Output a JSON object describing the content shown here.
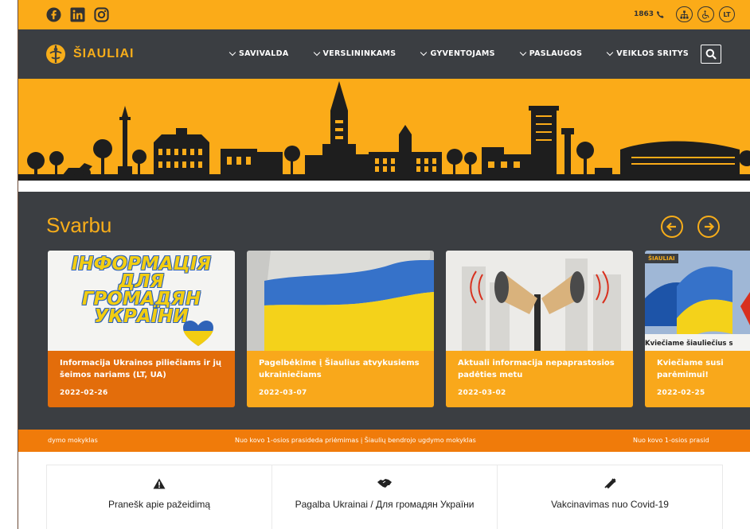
{
  "topbar": {
    "social_icons": [
      "facebook-icon",
      "linkedin-icon",
      "instagram-icon"
    ],
    "phone": "1863",
    "sitemap_icon": "sitemap-icon",
    "accessibility_icon": "wheelchair-icon",
    "language": "LT"
  },
  "nav": {
    "logo_text": "ŠIAULIAI",
    "menu": [
      "SAVIVALDA",
      "VERSLININKAMS",
      "GYVENTOJAMS",
      "PASLAUGOS",
      "VEIKLOS SRITYS"
    ],
    "search_icon": "search-icon"
  },
  "svarbu": {
    "title": "Svarbu",
    "cards": [
      {
        "image_text_lines": [
          "ІНФОРМАЦІЯ",
          "ДЛЯ",
          "ГРОМАДЯН",
          "УКРАЇНИ"
        ],
        "title": "Informacija Ukrainos piliečiams ir jų šeimos nariams (LT, UA)",
        "date": "2022-02-26",
        "color": "#e36d0b"
      },
      {
        "title": "Pagelbėkime į Šiaulius atvykusiems ukrainiečiams",
        "date": "2022-03-07",
        "color": "#f9a81b"
      },
      {
        "title": "Aktuali informacija nepaprastosios padėties metu",
        "date": "2022-03-02",
        "color": "#f9a81b"
      },
      {
        "badge": "ŠIAULIAI",
        "overlay": "Kviečiame šiauliečius s",
        "title": "Kviečiame susi parėmimui!",
        "date": "2022-02-25",
        "color": "#f9a81b"
      }
    ]
  },
  "ticker": {
    "items": [
      "dymo mokyklas",
      "Nuo kovo 1-osios prasideda priėmimas į Šiaulių bendrojo ugdymo mokyklas",
      "Nuo kovo 1-osios prasid"
    ]
  },
  "quick_links": [
    {
      "icon": "warning-icon",
      "label": "Pranešk apie pažeidimą"
    },
    {
      "icon": "handshake-icon",
      "label_lt": "Pagalba Ukrainai / ",
      "label_ua": "Для громадян України"
    },
    {
      "icon": "syringe-icon",
      "label": "Vakcinavimas nuo Covid-19"
    }
  ],
  "colors": {
    "accent": "#fbab18",
    "dark": "#3b3e42",
    "ticker": "#f07b0a"
  }
}
